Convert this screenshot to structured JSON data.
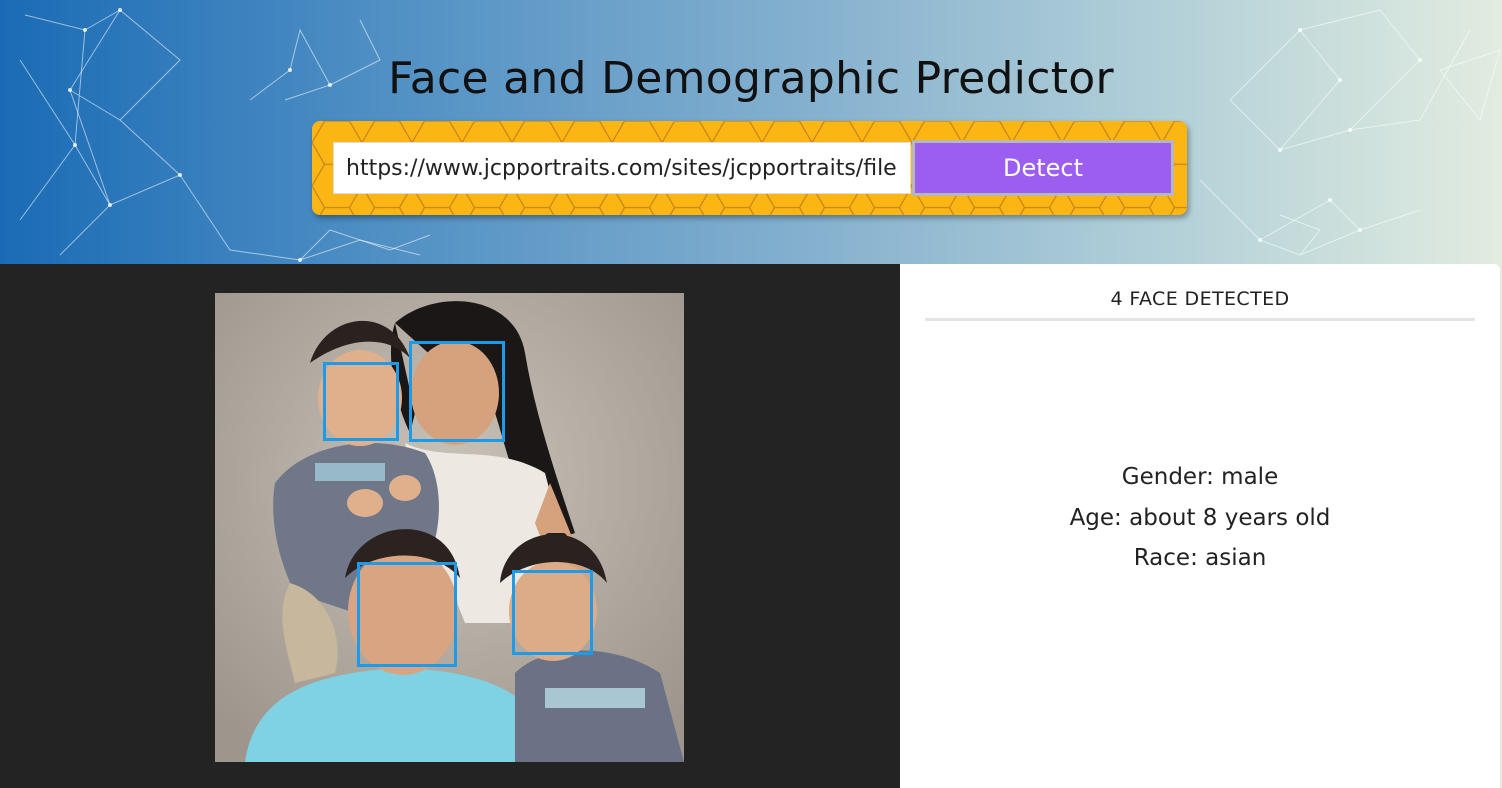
{
  "header": {
    "title": "Face and Demographic Predictor"
  },
  "search": {
    "url_value": "https://www.jcpportraits.com/sites/jcpportraits/files/",
    "detect_label": "Detect"
  },
  "results": {
    "faces_count_label": "4 FACE DETECTED",
    "faces_count": 4,
    "gender_line": "Gender: male",
    "age_line": "Age: about 8 years old",
    "race_line": "Race: asian"
  },
  "colors": {
    "background_gradient_start": "#1a6bb5",
    "background_gradient_end": "#e2ece0",
    "search_bar": "#fbb614",
    "detect_button": "#9c5ef0",
    "face_box": "#1d9ae8",
    "image_panel": "#232323"
  }
}
